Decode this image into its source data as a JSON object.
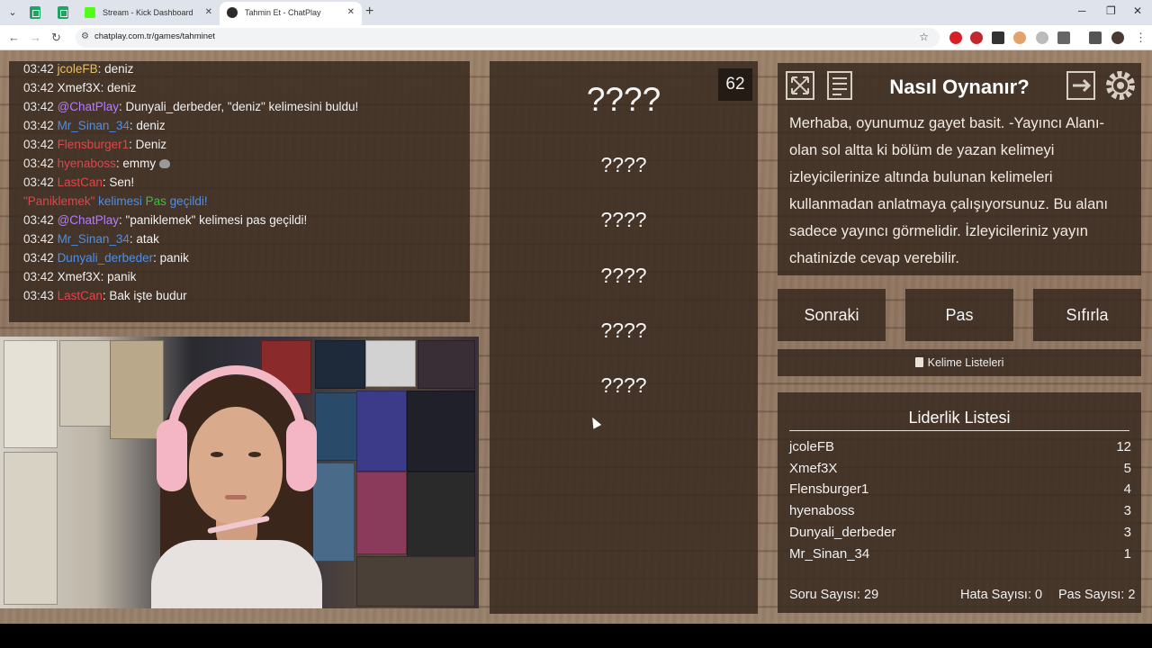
{
  "browser": {
    "tabs": [
      {
        "title": "Stream - Kick Dashboard",
        "active": false
      },
      {
        "title": "Tahmin Et - ChatPlay",
        "active": true
      }
    ],
    "url": "chatplay.com.tr/games/tahminet"
  },
  "chat": {
    "messages": [
      {
        "time": "03:42",
        "user": "jcoleFB",
        "user_color": "#e8c060",
        "text": ": deniz"
      },
      {
        "time": "03:42",
        "user": "Xmef3X",
        "user_color": "#f2f2f2",
        "text": ": deniz"
      },
      {
        "time": "03:42",
        "user": "@ChatPlay",
        "user_color": "#b57cff",
        "text": ": Dunyali_derbeder, \"deniz\" kelimesini buldu!"
      },
      {
        "time": "03:42",
        "user": "Mr_Sinan_34",
        "user_color": "#4d8ee8",
        "text": ": deniz"
      },
      {
        "time": "03:42",
        "user": "Flensburger1",
        "user_color": "#e0454a",
        "text": ": Deniz"
      },
      {
        "time": "03:42",
        "user": "hyenaboss",
        "user_color": "#e0454a",
        "text": ": emmy"
      },
      {
        "time": "03:42",
        "user": "LastCan",
        "user_color": "#e0454a",
        "text": ": Sen!"
      },
      {
        "time": "03:42",
        "user": "@ChatPlay",
        "user_color": "#b57cff",
        "text": ": \"paniklemek\" kelimesi pas geçildi!"
      },
      {
        "time": "03:42",
        "user": "Mr_Sinan_34",
        "user_color": "#4d8ee8",
        "text": ": atak"
      },
      {
        "time": "03:42",
        "user": "Dunyali_derbeder",
        "user_color": "#4d8ee8",
        "text": ": panik"
      },
      {
        "time": "03:42",
        "user": "Xmef3X",
        "user_color": "#f2f2f2",
        "text": ": panik"
      },
      {
        "time": "03:43",
        "user": "LastCan",
        "user_color": "#e0454a",
        "text": ": Bak işte budur"
      }
    ],
    "system": {
      "word": "\"Paniklemek\"",
      "mid": " kelimesi ",
      "status": "Pas",
      "end": " geçildi!"
    }
  },
  "game": {
    "timer": "62",
    "guesses": [
      "????",
      "????",
      "????",
      "????",
      "????",
      "????"
    ]
  },
  "howto": {
    "title": "Nasıl Oynanır?",
    "text": "Merhaba, oyunumuz gayet basit. -Yayıncı Alanı- olan sol altta ki bölüm de yazan kelimeyi izleyicilerinize altında bulunan kelimeleri kullanmadan anlatmaya çalışıyorsunuz. Bu alanı sadece yayıncı görmelidir. İzleyicileriniz yayın chatinizde cevap verebilir."
  },
  "controls": {
    "next": "Sonraki",
    "pass": "Pas",
    "reset": "Sıfırla",
    "word_lists": "Kelime Listeleri"
  },
  "leaderboard": {
    "title": "Liderlik Listesi",
    "rows": [
      {
        "name": "jcoleFB",
        "score": "12"
      },
      {
        "name": "Xmef3X",
        "score": "5"
      },
      {
        "name": "Flensburger1",
        "score": "4"
      },
      {
        "name": "hyenaboss",
        "score": "3"
      },
      {
        "name": "Dunyali_derbeder",
        "score": "3"
      },
      {
        "name": "Mr_Sinan_34",
        "score": "1"
      }
    ],
    "stats": {
      "questions_label": "Soru Sayısı:",
      "questions": "29",
      "errors_label": "Hata Sayısı:",
      "errors": "0",
      "passes_label": "Pas Sayısı:",
      "passes": "2"
    }
  },
  "colors": {
    "panel": "#34261c",
    "accent_purple": "#b57cff",
    "accent_blue": "#4d8ee8",
    "accent_red": "#e0454a",
    "accent_green": "#36c23a"
  }
}
